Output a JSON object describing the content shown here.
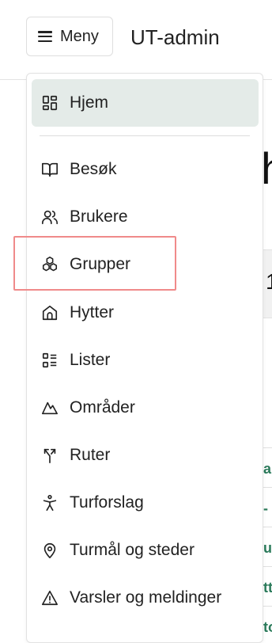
{
  "header": {
    "menu_label": "Meny",
    "app_title": "UT-admin"
  },
  "background": {
    "heading_fragment": "h",
    "number_fragment": "1",
    "green_fragments": [
      "ar",
      "-",
      "uk",
      "tt",
      "to"
    ]
  },
  "menu": {
    "items": [
      {
        "label": "Hjem",
        "icon": "dashboard-icon",
        "active": true
      },
      {
        "label": "Besøk",
        "icon": "book-open-icon"
      },
      {
        "label": "Brukere",
        "icon": "users-icon"
      },
      {
        "label": "Grupper",
        "icon": "group-cubes-icon"
      },
      {
        "label": "Hytter",
        "icon": "cabin-icon"
      },
      {
        "label": "Lister",
        "icon": "list-icon"
      },
      {
        "label": "Områder",
        "icon": "mountain-icon"
      },
      {
        "label": "Ruter",
        "icon": "route-split-icon"
      },
      {
        "label": "Turforslag",
        "icon": "person-icon"
      },
      {
        "label": "Turmål og steder",
        "icon": "map-pin-icon"
      },
      {
        "label": "Varsler og meldinger",
        "icon": "warning-icon"
      }
    ]
  },
  "colors": {
    "active_bg": "#e4ebe8",
    "highlight_border": "#f08a8a",
    "link_green": "#2a7a5a"
  }
}
